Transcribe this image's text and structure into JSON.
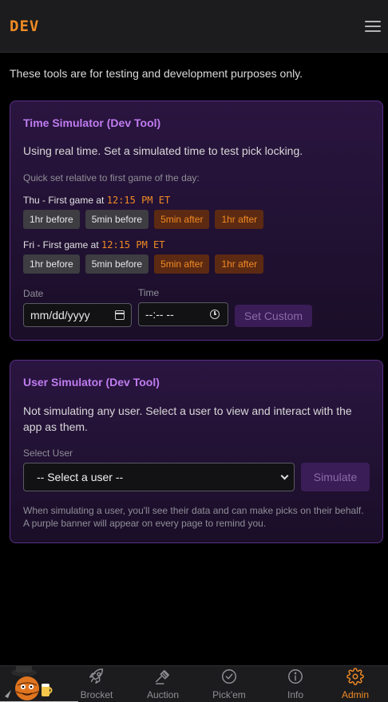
{
  "header": {
    "logo": "DEV",
    "menu_icon": "hamburger-menu-icon"
  },
  "notice": "These tools are for testing and development purposes only.",
  "time_simulator": {
    "title": "Time Simulator (Dev Tool)",
    "status": "Using real time. Set a simulated time to test pick locking.",
    "quick_label": "Quick set relative to first game of the day:",
    "days": [
      {
        "label": "Thu - First game at",
        "time": "12:15 PM ET",
        "buttons": [
          "1hr before",
          "5min before",
          "5min after",
          "1hr after"
        ]
      },
      {
        "label": "Fri - First game at",
        "time": "12:15 PM ET",
        "buttons": [
          "1hr before",
          "5min before",
          "5min after",
          "1hr after"
        ]
      }
    ],
    "date_label": "Date",
    "date_placeholder": "mm/dd/yyyy",
    "time_label": "Time",
    "time_placeholder": "--:-- --",
    "set_custom": "Set Custom"
  },
  "user_simulator": {
    "title": "User Simulator (Dev Tool)",
    "status_line1": "Not simulating any user. Select a user to view and interact with the",
    "status_line2": "app as them.",
    "select_label": "Select User",
    "select_value": "-- Select a user --",
    "simulate": "Simulate",
    "helper_line1": "When simulating a user, you'll see their data and can make picks on their behalf.",
    "helper_line2": "A purple banner will appear on every page to remind you."
  },
  "bottom_nav": {
    "items": [
      {
        "label": "Brocket",
        "icon": "rocket-icon"
      },
      {
        "label": "Auction",
        "icon": "gavel-icon"
      },
      {
        "label": "Pick'em",
        "icon": "check-circle-icon"
      },
      {
        "label": "Info",
        "icon": "info-icon"
      },
      {
        "label": "Admin",
        "icon": "gear-icon"
      }
    ],
    "active": "Admin"
  },
  "colors": {
    "accent_orange": "#f08a24",
    "accent_purple": "#c07cf0",
    "card_border": "#5a2f87"
  }
}
